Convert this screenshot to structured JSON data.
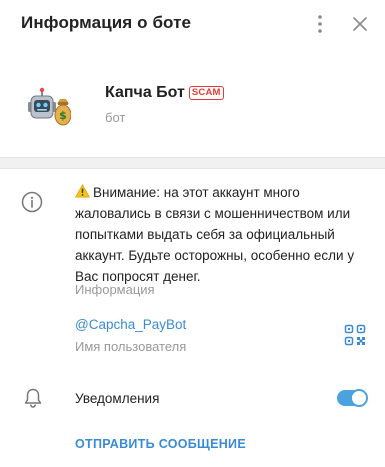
{
  "header": {
    "title": "Информация о боте",
    "more_icon": "more-vertical-icon",
    "close_icon": "close-icon"
  },
  "profile": {
    "name": "Капча Бот",
    "badge": "SCAM",
    "status": "бот",
    "avatar_icon": "robot-money-bag-icon"
  },
  "info": {
    "warning_icon": "warning-emoji-icon",
    "warning_text": "Внимание: на этот аккаунт много жаловались в связи с мошенничеством или попытками выдать себя за официальный аккаунт. Будьте осторожны, особенно если у Вас попросят денег.",
    "info_label": "Информация",
    "username": "@Capcha_PayBot",
    "username_label": "Имя пользователя"
  },
  "notifications": {
    "label": "Уведомления",
    "enabled": true
  },
  "actions": {
    "send_message": "ОТПРАВИТЬ СООБЩЕНИЕ"
  },
  "colors": {
    "accent": "#3a8bd6",
    "toggle": "#4aa3df",
    "scam": "#e53935",
    "muted": "#999999"
  }
}
